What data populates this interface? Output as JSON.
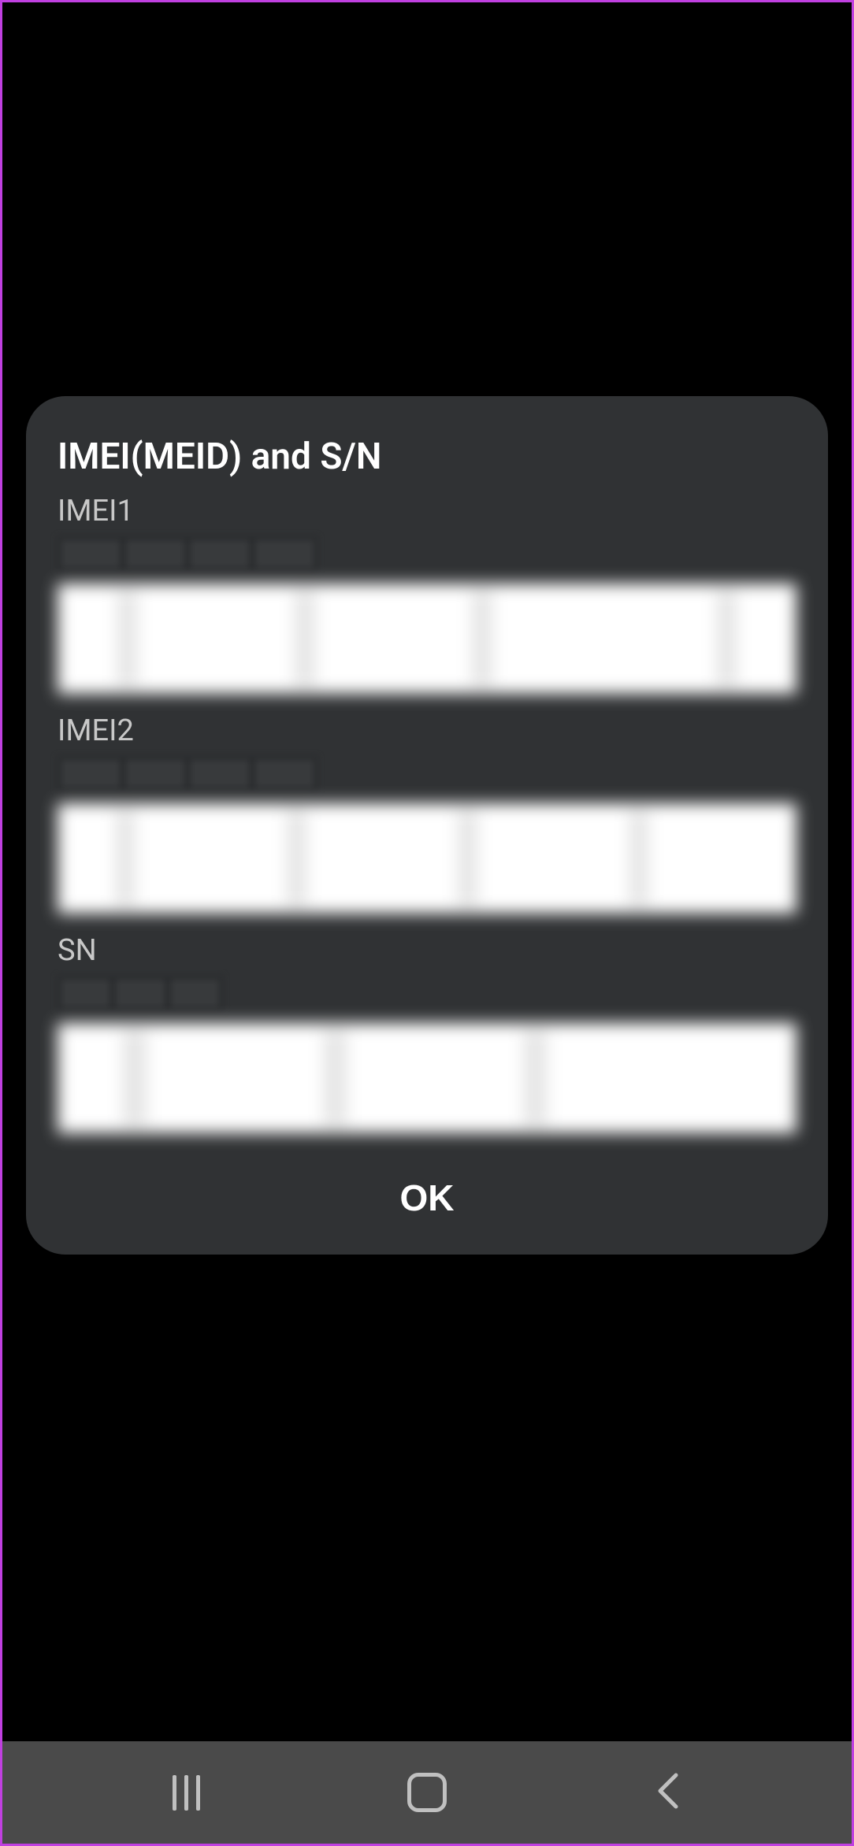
{
  "dialog": {
    "title": "IMEI(MEID) and S/N",
    "fields": [
      {
        "label": "IMEI1",
        "value_redacted": true
      },
      {
        "label": "IMEI2",
        "value_redacted": true
      },
      {
        "label": "SN",
        "value_redacted": true
      }
    ],
    "ok_button": "OK"
  },
  "nav": {
    "recents": "recents",
    "home": "home",
    "back": "back"
  }
}
